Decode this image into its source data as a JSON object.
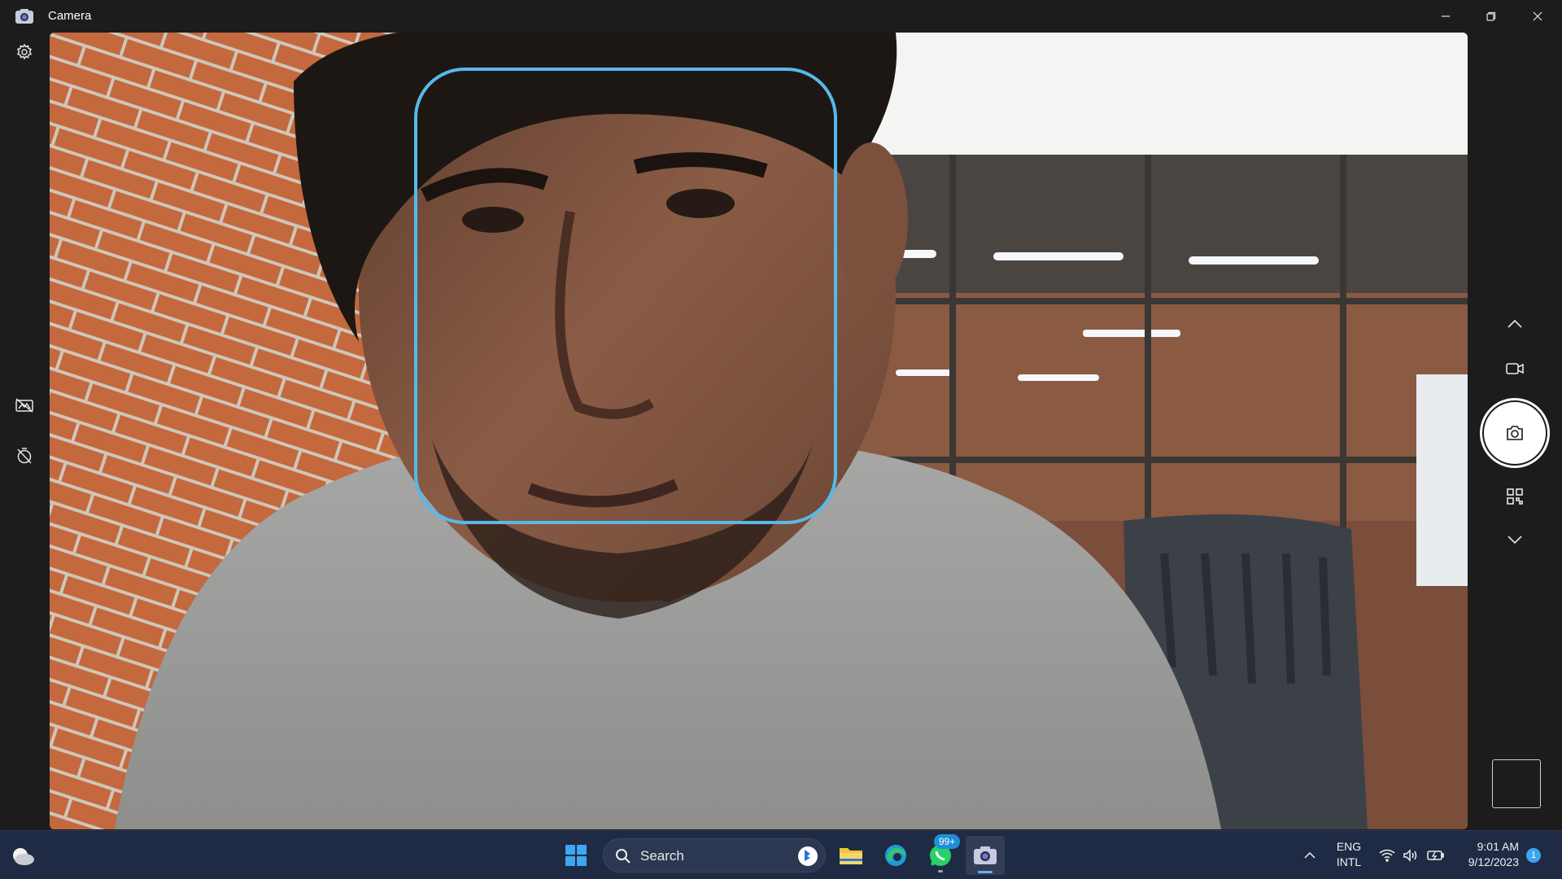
{
  "window": {
    "title": "Camera",
    "controls": [
      "minimize",
      "restore",
      "close"
    ]
  },
  "left_rail": {
    "items": [
      {
        "name": "settings",
        "icon": "gear-icon"
      },
      {
        "name": "hdr-off",
        "icon": "hdr-off-icon"
      },
      {
        "name": "timer-off",
        "icon": "timer-off-icon"
      }
    ]
  },
  "viewfinder": {
    "face_detection": true,
    "face_box_color": "#58b9e8"
  },
  "right_rail": {
    "items": [
      {
        "name": "mode-up",
        "icon": "chevron-up-icon"
      },
      {
        "name": "video-mode",
        "icon": "video-camera-icon"
      },
      {
        "name": "photo-shutter",
        "icon": "camera-icon"
      },
      {
        "name": "qr-scan-mode",
        "icon": "qr-code-icon"
      },
      {
        "name": "mode-down",
        "icon": "chevron-down-icon"
      },
      {
        "name": "last-capture-thumbnail",
        "icon": "thumbnail"
      }
    ]
  },
  "taskbar": {
    "weather_icon": "cloud-icon",
    "search": {
      "label": "Search"
    },
    "apps": [
      {
        "name": "start",
        "icon": "windows-logo-icon"
      },
      {
        "name": "file-explorer",
        "icon": "folder-icon"
      },
      {
        "name": "edge",
        "icon": "edge-icon"
      },
      {
        "name": "whatsapp",
        "icon": "whatsapp-icon",
        "badge": "99+"
      },
      {
        "name": "camera",
        "icon": "camera-icon",
        "active": true
      }
    ],
    "tray": {
      "language_line1": "ENG",
      "language_line2": "INTL",
      "time": "9:01 AM",
      "date": "9/12/2023",
      "notification_count": "1"
    }
  }
}
